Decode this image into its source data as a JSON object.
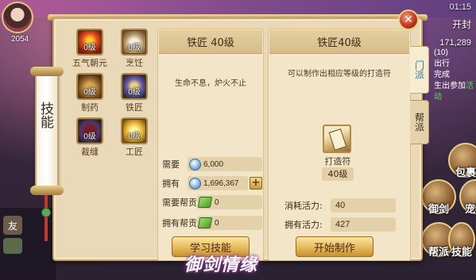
{
  "hud": {
    "time": "01:15",
    "place": "开封",
    "coins": "171,289",
    "player_level": "2054"
  },
  "side_panel": {
    "lines": [
      "(10)",
      "出行",
      "完成",
      "生出参加"
    ],
    "activity": "活动"
  },
  "right_actions": [
    "包裹",
    "御剑",
    "宠物",
    "帮派",
    "技能"
  ],
  "left_chat": {
    "icon_label": "友"
  },
  "scroll_tab": {
    "label": "技能"
  },
  "skills": [
    {
      "name": "五气朝元",
      "level": "0级",
      "icon": "fire-orb-icon"
    },
    {
      "name": "烹饪",
      "level": "0级",
      "icon": "dumplings-icon"
    },
    {
      "name": "制药",
      "level": "0级",
      "icon": "gourd-icon"
    },
    {
      "name": "铁匠",
      "level": "0级",
      "icon": "anvil-icon"
    },
    {
      "name": "裁缝",
      "level": "0级",
      "icon": "thread-spool-icon"
    },
    {
      "name": "工匠",
      "level": "0级",
      "icon": "gold-ingot-icon"
    }
  ],
  "middle": {
    "title": "铁匠 40级",
    "description": "生命不息，炉火不止",
    "need_label": "需要",
    "need_value": "6,000",
    "have_label": "拥有",
    "have_value": "1,696,367",
    "need_contrib_label": "需要帮贡",
    "need_contrib_value": "0",
    "have_contrib_label": "拥有帮贡",
    "have_contrib_value": "0",
    "learn_button": "学习技能"
  },
  "right": {
    "title": "铁匠40级",
    "description": "可以制作出相应等级的打造符",
    "item_name": "打造符",
    "item_level": "40级",
    "cost_label": "消耗活力:",
    "cost_value": "40",
    "have_label": "拥有活力:",
    "have_value": "427",
    "make_button": "开始制作"
  },
  "side_tabs": [
    {
      "label": "门派",
      "active": true
    },
    {
      "label": "帮派",
      "active": false
    }
  ],
  "close_label": "✕",
  "logo": {
    "text": "御剑情缘"
  },
  "colors": {
    "panel_bg": "#e9d9b8",
    "active_tab_text": "#1b7dbd",
    "activity_green": "#3ff03f"
  }
}
